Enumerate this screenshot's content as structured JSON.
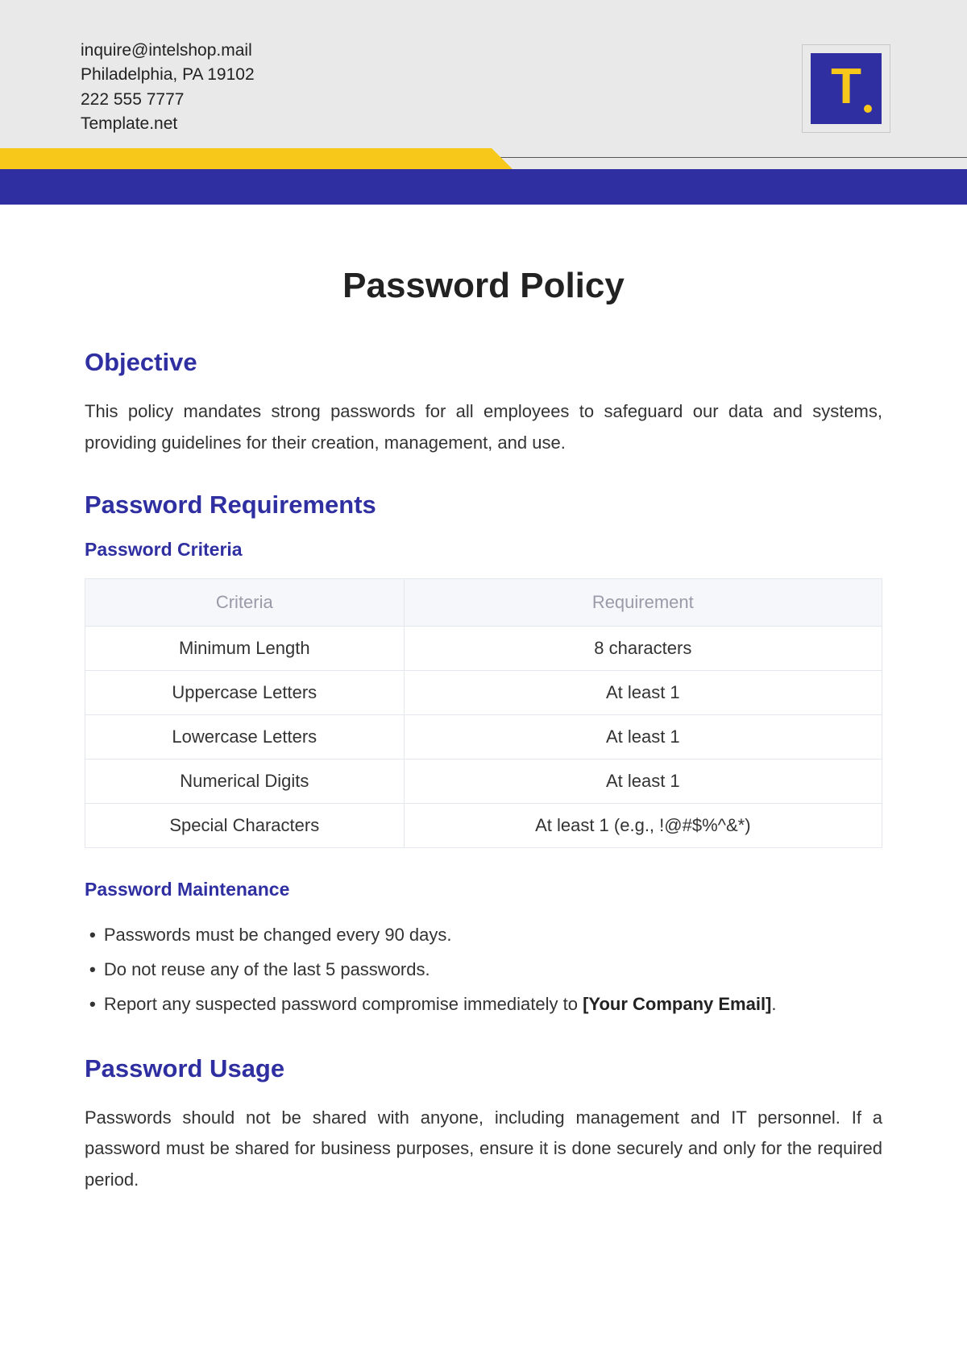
{
  "header": {
    "email": "inquire@intelshop.mail",
    "address": "Philadelphia, PA 19102",
    "phone": "222 555 7777",
    "site": "Template.net",
    "logo_letter": "T"
  },
  "title": "Password Policy",
  "sections": {
    "objective": {
      "heading": "Objective",
      "body": "This policy mandates strong passwords for all employees to safeguard our data and systems, providing guidelines for their creation, management, and use."
    },
    "requirements": {
      "heading": "Password Requirements",
      "criteria_heading": "Password Criteria",
      "table": {
        "headers": [
          "Criteria",
          "Requirement"
        ],
        "rows": [
          [
            "Minimum Length",
            "8 characters"
          ],
          [
            "Uppercase Letters",
            "At least 1"
          ],
          [
            "Lowercase Letters",
            "At least 1"
          ],
          [
            "Numerical Digits",
            "At least 1"
          ],
          [
            "Special Characters",
            "At least 1 (e.g., !@#$%^&*)"
          ]
        ]
      },
      "maintenance_heading": "Password Maintenance",
      "maintenance_items": [
        "Passwords must be changed every 90 days.",
        "Do not reuse any of the last 5 passwords.",
        "Report any suspected password compromise immediately to "
      ],
      "maintenance_bold_tail": "[Your Company Email]"
    },
    "usage": {
      "heading": "Password Usage",
      "body": "Passwords should not be shared with anyone, including management and IT personnel. If a password must be shared for business purposes, ensure it is done securely and only for the required period."
    }
  }
}
